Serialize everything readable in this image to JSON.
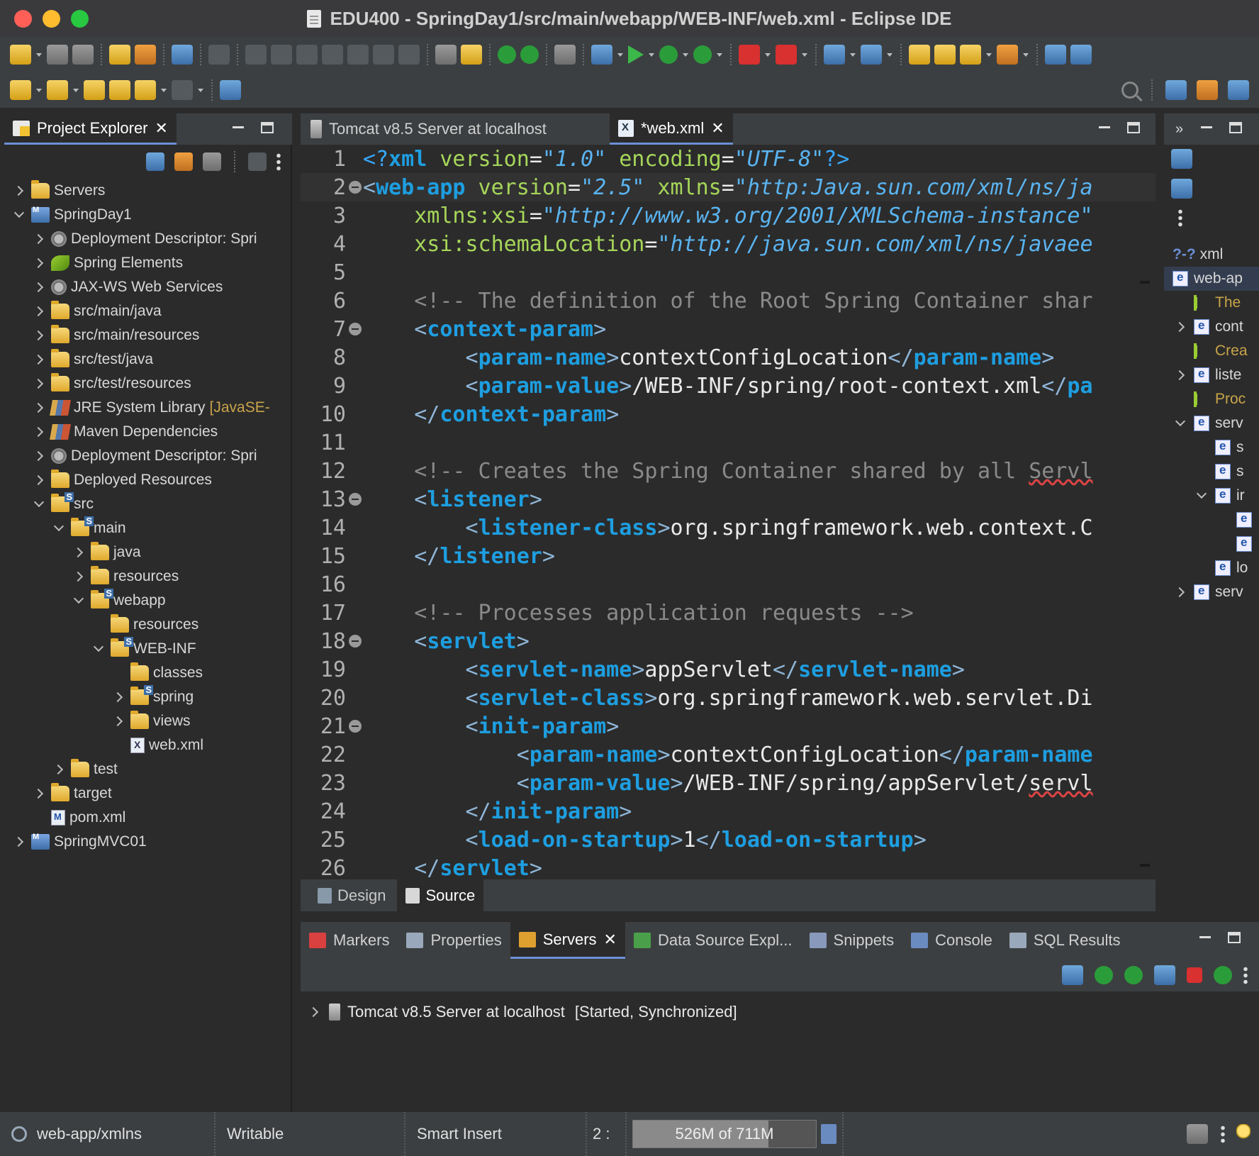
{
  "window": {
    "title": "EDU400 - SpringDay1/src/main/webapp/WEB-INF/web.xml - Eclipse IDE"
  },
  "project_explorer": {
    "title": "Project Explorer",
    "tree": [
      {
        "label": "Servers",
        "depth": 0,
        "expander": "right",
        "icon": "folder-icon"
      },
      {
        "label": "SpringDay1",
        "depth": 0,
        "expander": "down",
        "icon": "project-icon"
      },
      {
        "label": "Deployment Descriptor: Spri",
        "depth": 1,
        "expander": "right",
        "icon": "deployment-descriptor-icon"
      },
      {
        "label": "Spring Elements",
        "depth": 1,
        "expander": "right",
        "icon": "spring-leaf-icon"
      },
      {
        "label": "JAX-WS Web Services",
        "depth": 1,
        "expander": "right",
        "icon": "web-services-icon"
      },
      {
        "label": "src/main/java",
        "depth": 1,
        "expander": "right",
        "icon": "source-folder-icon"
      },
      {
        "label": "src/main/resources",
        "depth": 1,
        "expander": "right",
        "icon": "source-folder-icon"
      },
      {
        "label": "src/test/java",
        "depth": 1,
        "expander": "right",
        "icon": "source-folder-icon"
      },
      {
        "label": "src/test/resources",
        "depth": 1,
        "expander": "right",
        "icon": "source-folder-icon"
      },
      {
        "label": "JRE System Library",
        "suffix": "[JavaSE-",
        "depth": 1,
        "expander": "right",
        "icon": "library-icon"
      },
      {
        "label": "Maven Dependencies",
        "depth": 1,
        "expander": "right",
        "icon": "library-icon"
      },
      {
        "label": "Deployment Descriptor: Spri",
        "depth": 1,
        "expander": "right",
        "icon": "deployment-descriptor-icon"
      },
      {
        "label": "Deployed Resources",
        "depth": 1,
        "expander": "right",
        "icon": "deployed-resources-icon"
      },
      {
        "label": "src",
        "depth": 1,
        "expander": "down",
        "icon": "spring-folder-icon"
      },
      {
        "label": "main",
        "depth": 2,
        "expander": "down",
        "icon": "spring-folder-icon"
      },
      {
        "label": "java",
        "depth": 3,
        "expander": "right",
        "icon": "folder-icon"
      },
      {
        "label": "resources",
        "depth": 3,
        "expander": "right",
        "icon": "folder-icon"
      },
      {
        "label": "webapp",
        "depth": 3,
        "expander": "down",
        "icon": "spring-folder-icon"
      },
      {
        "label": "resources",
        "depth": 4,
        "expander": "none",
        "icon": "folder-icon"
      },
      {
        "label": "WEB-INF",
        "depth": 4,
        "expander": "down",
        "icon": "spring-folder-icon"
      },
      {
        "label": "classes",
        "depth": 5,
        "expander": "none",
        "icon": "folder-icon"
      },
      {
        "label": "spring",
        "depth": 5,
        "expander": "right",
        "icon": "spring-folder-icon"
      },
      {
        "label": "views",
        "depth": 5,
        "expander": "right",
        "icon": "folder-icon"
      },
      {
        "label": "web.xml",
        "depth": 5,
        "expander": "none",
        "icon": "xml-file-icon"
      },
      {
        "label": "test",
        "depth": 2,
        "expander": "right",
        "icon": "folder-icon"
      },
      {
        "label": "target",
        "depth": 1,
        "expander": "right",
        "icon": "folder-icon"
      },
      {
        "label": "pom.xml",
        "depth": 1,
        "expander": "none",
        "icon": "pom-file-icon"
      },
      {
        "label": "SpringMVC01",
        "depth": 0,
        "expander": "right",
        "icon": "project-icon"
      }
    ]
  },
  "editor": {
    "tabs": [
      {
        "label": "Tomcat v8.5 Server at localhost",
        "icon": "server-icon",
        "active": false
      },
      {
        "label": "*web.xml",
        "icon": "xml-file-icon",
        "active": true
      }
    ],
    "current_line": 2,
    "lines": [
      {
        "n": "1",
        "fold": false,
        "parts": [
          [
            "pi",
            "<?"
          ],
          [
            "tag",
            "xml"
          ],
          [
            "attr",
            " version"
          ],
          [
            "txt",
            "="
          ],
          [
            "val",
            "\"1.0\""
          ],
          [
            "attr",
            " encoding"
          ],
          [
            "txt",
            "="
          ],
          [
            "val",
            "\"UTF-8\""
          ],
          [
            "pi",
            "?>"
          ]
        ]
      },
      {
        "n": "2",
        "fold": true,
        "parts": [
          [
            "brk",
            "<"
          ],
          [
            "tag",
            "web-app"
          ],
          [
            "attr",
            " version"
          ],
          [
            "txt",
            "="
          ],
          [
            "val",
            "\"2.5\""
          ],
          [
            "attr",
            " xmlns"
          ],
          [
            "txt",
            "="
          ],
          [
            "val",
            "\"http:Java.sun.com/xml/ns/ja"
          ]
        ]
      },
      {
        "n": "3",
        "fold": false,
        "parts": [
          [
            "attr",
            "    xmlns:xsi"
          ],
          [
            "txt",
            "="
          ],
          [
            "val",
            "\"http://www.w3.org/2001/XMLSchema-instance\""
          ]
        ]
      },
      {
        "n": "4",
        "fold": false,
        "parts": [
          [
            "attr",
            "    xsi:schemaLocation"
          ],
          [
            "txt",
            "="
          ],
          [
            "val",
            "\"http://java.sun.com/xml/ns/javaee"
          ]
        ]
      },
      {
        "n": "5",
        "fold": false,
        "parts": []
      },
      {
        "n": "6",
        "fold": false,
        "parts": [
          [
            "com",
            "    <!-- The definition of the Root Spring Container shar"
          ]
        ]
      },
      {
        "n": "7",
        "fold": true,
        "parts": [
          [
            "brk",
            "    <"
          ],
          [
            "tag",
            "context-param"
          ],
          [
            "brk",
            ">"
          ]
        ]
      },
      {
        "n": "8",
        "fold": false,
        "parts": [
          [
            "brk",
            "        <"
          ],
          [
            "tag",
            "param-name"
          ],
          [
            "brk",
            ">"
          ],
          [
            "txt",
            "contextConfigLocation"
          ],
          [
            "brk",
            "</"
          ],
          [
            "tag",
            "param-name"
          ],
          [
            "brk",
            ">"
          ]
        ]
      },
      {
        "n": "9",
        "fold": false,
        "parts": [
          [
            "brk",
            "        <"
          ],
          [
            "tag",
            "param-value"
          ],
          [
            "brk",
            ">"
          ],
          [
            "txt",
            "/WEB-INF/spring/root-context.xml"
          ],
          [
            "brk",
            "</"
          ],
          [
            "tag",
            "pa"
          ]
        ]
      },
      {
        "n": "10",
        "fold": false,
        "parts": [
          [
            "brk",
            "    </"
          ],
          [
            "tag",
            "context-param"
          ],
          [
            "brk",
            ">"
          ]
        ]
      },
      {
        "n": "11",
        "fold": false,
        "parts": []
      },
      {
        "n": "12",
        "fold": false,
        "parts": [
          [
            "com",
            "    <!-- Creates the Spring Container shared by all "
          ],
          [
            "comw",
            "Servl"
          ]
        ]
      },
      {
        "n": "13",
        "fold": true,
        "parts": [
          [
            "brk",
            "    <"
          ],
          [
            "tag",
            "listener"
          ],
          [
            "brk",
            ">"
          ]
        ]
      },
      {
        "n": "14",
        "fold": false,
        "parts": [
          [
            "brk",
            "        <"
          ],
          [
            "tag",
            "listener-class"
          ],
          [
            "brk",
            ">"
          ],
          [
            "txt",
            "org.springframework.web.context.C"
          ]
        ]
      },
      {
        "n": "15",
        "fold": false,
        "parts": [
          [
            "brk",
            "    </"
          ],
          [
            "tag",
            "listener"
          ],
          [
            "brk",
            ">"
          ]
        ]
      },
      {
        "n": "16",
        "fold": false,
        "parts": []
      },
      {
        "n": "17",
        "fold": false,
        "parts": [
          [
            "com",
            "    <!-- Processes application requests -->"
          ]
        ]
      },
      {
        "n": "18",
        "fold": true,
        "parts": [
          [
            "brk",
            "    <"
          ],
          [
            "tag",
            "servlet"
          ],
          [
            "brk",
            ">"
          ]
        ]
      },
      {
        "n": "19",
        "fold": false,
        "parts": [
          [
            "brk",
            "        <"
          ],
          [
            "tag",
            "servlet-name"
          ],
          [
            "brk",
            ">"
          ],
          [
            "txt",
            "appServlet"
          ],
          [
            "brk",
            "</"
          ],
          [
            "tag",
            "servlet-name"
          ],
          [
            "brk",
            ">"
          ]
        ]
      },
      {
        "n": "20",
        "fold": false,
        "parts": [
          [
            "brk",
            "        <"
          ],
          [
            "tag",
            "servlet-class"
          ],
          [
            "brk",
            ">"
          ],
          [
            "txt",
            "org.springframework.web.servlet.Di"
          ]
        ]
      },
      {
        "n": "21",
        "fold": true,
        "parts": [
          [
            "brk",
            "        <"
          ],
          [
            "tag",
            "init-param"
          ],
          [
            "brk",
            ">"
          ]
        ]
      },
      {
        "n": "22",
        "fold": false,
        "parts": [
          [
            "brk",
            "            <"
          ],
          [
            "tag",
            "param-name"
          ],
          [
            "brk",
            ">"
          ],
          [
            "txt",
            "contextConfigLocation"
          ],
          [
            "brk",
            "</"
          ],
          [
            "tag",
            "param-name"
          ]
        ]
      },
      {
        "n": "23",
        "fold": false,
        "parts": [
          [
            "brk",
            "            <"
          ],
          [
            "tag",
            "param-value"
          ],
          [
            "brk",
            ">"
          ],
          [
            "txt",
            "/WEB-INF/spring/appServlet/"
          ],
          [
            "txtw",
            "servl"
          ]
        ]
      },
      {
        "n": "24",
        "fold": false,
        "parts": [
          [
            "brk",
            "        </"
          ],
          [
            "tag",
            "init-param"
          ],
          [
            "brk",
            ">"
          ]
        ]
      },
      {
        "n": "25",
        "fold": false,
        "parts": [
          [
            "brk",
            "        <"
          ],
          [
            "tag",
            "load-on-startup"
          ],
          [
            "brk",
            ">"
          ],
          [
            "txt",
            "1"
          ],
          [
            "brk",
            "</"
          ],
          [
            "tag",
            "load-on-startup"
          ],
          [
            "brk",
            ">"
          ]
        ]
      },
      {
        "n": "26",
        "fold": false,
        "parts": [
          [
            "brk",
            "    </"
          ],
          [
            "tag",
            "servlet"
          ],
          [
            "brk",
            ">"
          ]
        ]
      }
    ],
    "bottom_tabs": [
      {
        "label": "Design",
        "active": false
      },
      {
        "label": "Source",
        "active": true
      }
    ]
  },
  "outline": {
    "items": [
      {
        "label": "xml",
        "depth": 0,
        "kind": "pi",
        "expander": "none"
      },
      {
        "label": "web-ap",
        "depth": 0,
        "kind": "element",
        "expander": "none",
        "selected": true
      },
      {
        "label": "The",
        "depth": 1,
        "kind": "comment",
        "expander": "none"
      },
      {
        "label": "cont",
        "depth": 1,
        "kind": "element",
        "expander": "right"
      },
      {
        "label": "Crea",
        "depth": 1,
        "kind": "comment",
        "expander": "none"
      },
      {
        "label": "liste",
        "depth": 1,
        "kind": "element",
        "expander": "right"
      },
      {
        "label": "Proc",
        "depth": 1,
        "kind": "comment",
        "expander": "none"
      },
      {
        "label": "serv",
        "depth": 1,
        "kind": "element",
        "expander": "down"
      },
      {
        "label": "s",
        "depth": 2,
        "kind": "element",
        "expander": "none"
      },
      {
        "label": "s",
        "depth": 2,
        "kind": "element",
        "expander": "none"
      },
      {
        "label": "ir",
        "depth": 2,
        "kind": "element",
        "expander": "down"
      },
      {
        "label": "",
        "depth": 3,
        "kind": "element",
        "expander": "none"
      },
      {
        "label": "",
        "depth": 3,
        "kind": "element",
        "expander": "none"
      },
      {
        "label": "lo",
        "depth": 2,
        "kind": "element",
        "expander": "none"
      },
      {
        "label": "serv",
        "depth": 1,
        "kind": "element",
        "expander": "right"
      }
    ]
  },
  "bottom_panel": {
    "tabs": [
      {
        "label": "Markers",
        "icon": "markers-icon",
        "active": false
      },
      {
        "label": "Properties",
        "icon": "properties-icon",
        "active": false
      },
      {
        "label": "Servers",
        "icon": "servers-icon",
        "active": true
      },
      {
        "label": "Data Source Expl...",
        "icon": "data-source-icon",
        "active": false
      },
      {
        "label": "Snippets",
        "icon": "snippets-icon",
        "active": false
      },
      {
        "label": "Console",
        "icon": "console-icon",
        "active": false
      },
      {
        "label": "SQL Results",
        "icon": "sql-results-icon",
        "active": false
      }
    ],
    "server_row": {
      "name": "Tomcat v8.5 Server at localhost",
      "state": "[Started, Synchronized]"
    }
  },
  "status_bar": {
    "path": "web-app/xmlns",
    "writable": "Writable",
    "insert_mode": "Smart Insert",
    "position": "2 :",
    "heap": "526M of 711M",
    "heap_used_fraction": 0.74
  },
  "colors": {
    "accent": "#6c8fd6",
    "tag": "#1e9ee0",
    "attribute": "#a6d65a",
    "value": "#5ab4f0",
    "comment": "#8a8a8a"
  }
}
